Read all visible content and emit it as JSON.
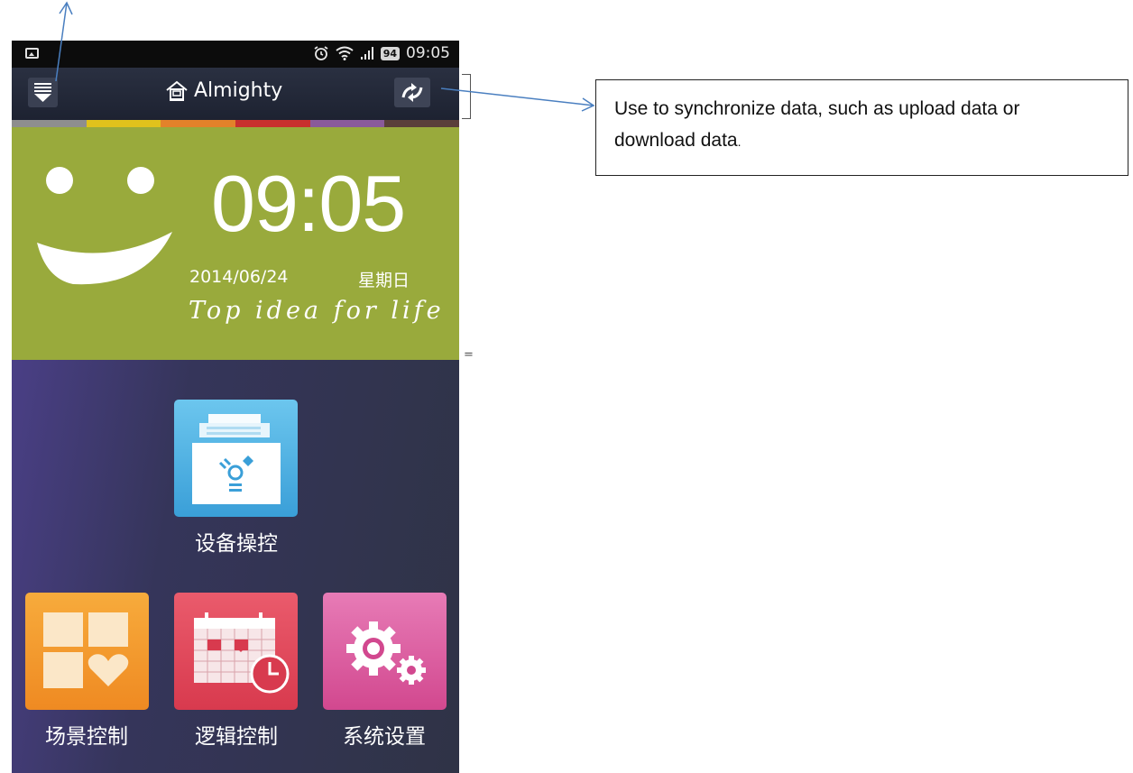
{
  "status_bar": {
    "time": "09:05",
    "battery": "94",
    "icons": [
      "image-icon",
      "alarm-icon",
      "wifi-icon",
      "signal-icon",
      "battery-icon"
    ]
  },
  "title_bar": {
    "title": "Almighty",
    "icons": [
      "menu-icon",
      "home-icon",
      "sync-icon"
    ]
  },
  "color_strip": [
    "#8e8e8e",
    "#e0c21c",
    "#e3822a",
    "#c8302e",
    "#8a5a9a",
    "#5a3f3a"
  ],
  "clock": {
    "time": "09:05",
    "date": "2014/06/24",
    "weekday": "星期日",
    "slogan": "Top idea for life",
    "panel_color": "#99aa3c"
  },
  "tiles": [
    {
      "label": "设备操控",
      "icon": "device-control-icon",
      "color": "#4db4e6"
    },
    {
      "label": "场景控制",
      "icon": "scene-control-icon",
      "color": "#f39a2c"
    },
    {
      "label": "逻辑控制",
      "icon": "logic-control-icon",
      "color": "#e04a5e"
    },
    {
      "label": "系统设置",
      "icon": "system-settings-icon",
      "color": "#d95aa0"
    }
  ],
  "annotation": {
    "text_line1": "Use to synchronize data, such as upload data or",
    "text_line2": "download data",
    "text_period": "."
  },
  "arrow_color": "#4a7fc0"
}
